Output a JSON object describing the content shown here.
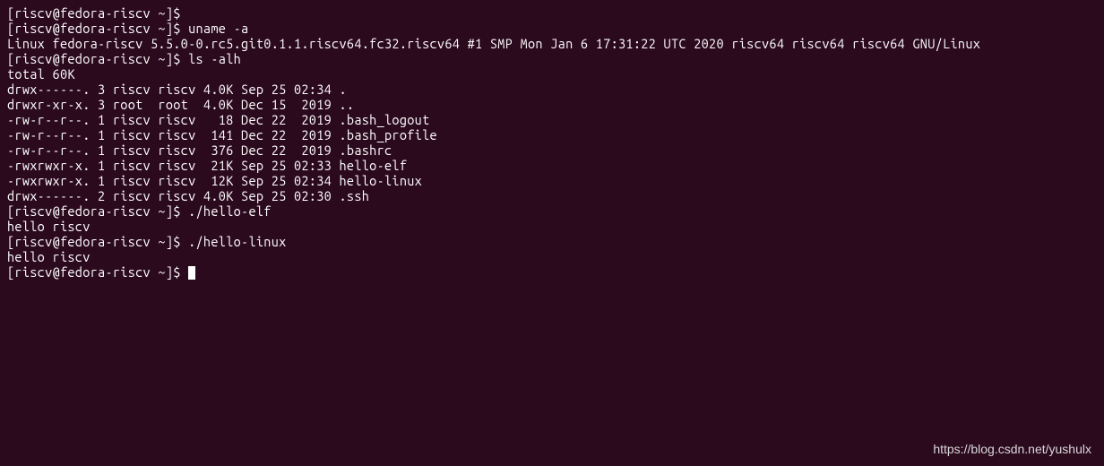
{
  "prompt": "[riscv@fedora-riscv ~]$",
  "lines": [
    {
      "prompt": "[riscv@fedora-riscv ~]$",
      "cmd": ""
    },
    {
      "prompt": "[riscv@fedora-riscv ~]$",
      "cmd": " uname -a"
    },
    {
      "text": "Linux fedora-riscv 5.5.0-0.rc5.git0.1.1.riscv64.fc32.riscv64 #1 SMP Mon Jan 6 17:31:22 UTC 2020 riscv64 riscv64 riscv64 GNU/Linux"
    },
    {
      "prompt": "[riscv@fedora-riscv ~]$",
      "cmd": " ls -alh"
    },
    {
      "text": "total 60K"
    },
    {
      "text": "drwx------. 3 riscv riscv 4.0K Sep 25 02:34 ."
    },
    {
      "text": "drwxr-xr-x. 3 root  root  4.0K Dec 15  2019 .."
    },
    {
      "text": "-rw-r--r--. 1 riscv riscv   18 Dec 22  2019 .bash_logout"
    },
    {
      "text": "-rw-r--r--. 1 riscv riscv  141 Dec 22  2019 .bash_profile"
    },
    {
      "text": "-rw-r--r--. 1 riscv riscv  376 Dec 22  2019 .bashrc"
    },
    {
      "text": "-rwxrwxr-x. 1 riscv riscv  21K Sep 25 02:33 hello-elf"
    },
    {
      "text": "-rwxrwxr-x. 1 riscv riscv  12K Sep 25 02:34 hello-linux"
    },
    {
      "text": "drwx------. 2 riscv riscv 4.0K Sep 25 02:30 .ssh"
    },
    {
      "prompt": "[riscv@fedora-riscv ~]$",
      "cmd": " ./hello-elf"
    },
    {
      "text": "hello riscv"
    },
    {
      "prompt": "[riscv@fedora-riscv ~]$",
      "cmd": " ./hello-linux"
    },
    {
      "text": "hello riscv"
    },
    {
      "prompt": "[riscv@fedora-riscv ~]$",
      "cmd": " ",
      "cursor": true
    }
  ],
  "watermark": "https://blog.csdn.net/yushulx"
}
